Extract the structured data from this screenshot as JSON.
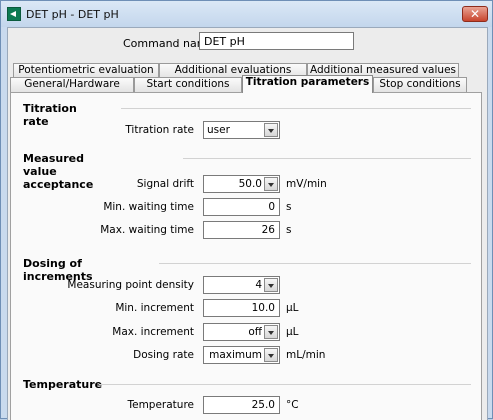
{
  "window": {
    "title": "DET pH - DET pH"
  },
  "command": {
    "label": "Command name",
    "value": "DET pH"
  },
  "tabs": {
    "row1": [
      "Potentiometric evaluation",
      "Additional evaluations",
      "Additional measured values"
    ],
    "row2": [
      "General/Hardware",
      "Start conditions",
      "Titration parameters",
      "Stop conditions"
    ],
    "active": "Titration parameters"
  },
  "titration_rate": {
    "heading": "Titration rate",
    "rate": {
      "label": "Titration rate",
      "value": "user"
    }
  },
  "measured_value_acceptance": {
    "heading": "Measured value acceptance",
    "signal_drift": {
      "label": "Signal drift",
      "value": "50.0",
      "unit": "mV/min"
    },
    "min_waiting_time": {
      "label": "Min. waiting time",
      "value": "0",
      "unit": "s"
    },
    "max_waiting_time": {
      "label": "Max. waiting time",
      "value": "26",
      "unit": "s"
    }
  },
  "dosing_of_increments": {
    "heading": "Dosing of increments",
    "measuring_point_density": {
      "label": "Measuring point density",
      "value": "4"
    },
    "min_increment": {
      "label": "Min. increment",
      "value": "10.0",
      "unit": "µL"
    },
    "max_increment": {
      "label": "Max. increment",
      "value": "off",
      "unit": "µL"
    },
    "dosing_rate": {
      "label": "Dosing rate",
      "value": "maximum",
      "unit": "mL/min"
    }
  },
  "temperature": {
    "heading": "Temperature",
    "temperature": {
      "label": "Temperature",
      "value": "25.0",
      "unit": "°C"
    }
  },
  "icons": {
    "app": "app-icon",
    "close": "close-icon",
    "dropdown": "chevron-down-icon"
  }
}
